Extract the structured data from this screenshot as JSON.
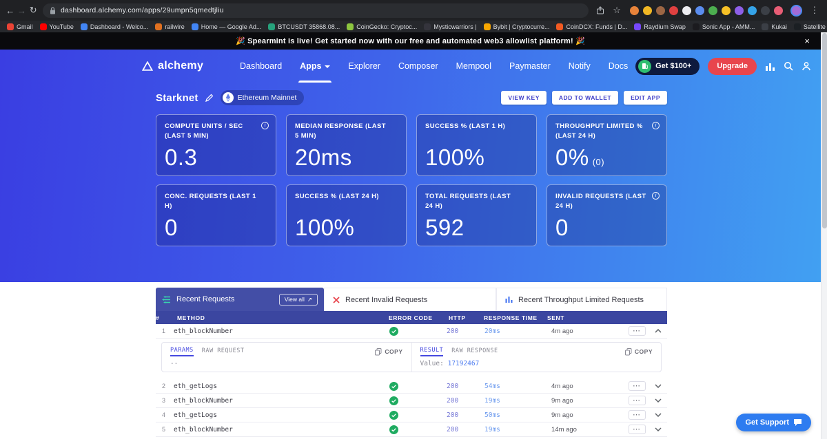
{
  "icons": {
    "back": "←",
    "forward": "→",
    "reload": "↻",
    "more": "⋮",
    "star": "☆",
    "close": "×",
    "dots": "⋯",
    "external": "↗"
  },
  "colors": {
    "gradient_start": "#3a3ee2",
    "gradient_end": "#41a0f2",
    "accent_indigo": "#3b46a0",
    "upgrade_red": "#e8454d",
    "success_green": "#1fab61",
    "http_blue": "#7577d6",
    "time_blue": "#6d9bee"
  },
  "browser": {
    "url": "dashboard.alchemy.com/apps/29umpn5qmedtjliu",
    "extensions": [
      {
        "color": "#e8833a"
      },
      {
        "color": "#f2b824"
      },
      {
        "color": "#9c6644"
      },
      {
        "color": "#e04040"
      },
      {
        "color": "#ececf0"
      },
      {
        "color": "#5b8def"
      },
      {
        "color": "#4cae4f"
      },
      {
        "color": "#f6c026"
      },
      {
        "color": "#8e5fe8"
      },
      {
        "color": "#35a3e8"
      },
      {
        "color": "#3b3f46"
      },
      {
        "color": "#e85d75"
      }
    ],
    "bookmarks": [
      {
        "label": "Gmail",
        "color": "#ea4335"
      },
      {
        "label": "YouTube",
        "color": "#ff0000"
      },
      {
        "label": "Dashboard - Welco...",
        "color": "#4285f4"
      },
      {
        "label": "railwire",
        "color": "#e07020"
      },
      {
        "label": "Home — Google Ad...",
        "color": "#4285f4"
      },
      {
        "label": "BTCUSDT 35868.08...",
        "color": "#26a17b"
      },
      {
        "label": "CoinGecko: Cryptoc...",
        "color": "#8dc63f"
      },
      {
        "label": "Mysticwarriors |",
        "color": "#34343c"
      },
      {
        "label": "Bybit | Cryptocurre...",
        "color": "#f7a600"
      },
      {
        "label": "CoinDCX: Funds | D...",
        "color": "#f15a22"
      },
      {
        "label": "Raydium Swap",
        "color": "#7748fc"
      },
      {
        "label": "Sonic App - AMM...",
        "color": "#1b1b1f"
      },
      {
        "label": "Kukai",
        "color": "#3b3f46"
      },
      {
        "label": "Satellite by Axelar",
        "color": "#1b1f23"
      }
    ]
  },
  "banner": {
    "text": "🎉 Spearmint is live! Get started now with our free and automated web3 allowlist platform! 🎉"
  },
  "header": {
    "brand": "alchemy",
    "nav": [
      {
        "label": "Dashboard"
      },
      {
        "label": "Apps",
        "active": true,
        "caret": true
      },
      {
        "label": "Explorer"
      },
      {
        "label": "Composer"
      },
      {
        "label": "Mempool"
      },
      {
        "label": "Paymaster"
      },
      {
        "label": "Notify"
      },
      {
        "label": "Docs"
      }
    ],
    "credits_button": "Get $100+",
    "upgrade_button": "Upgrade"
  },
  "app": {
    "title": "Starknet",
    "network": "Ethereum Mainnet",
    "actions": [
      {
        "label": "VIEW KEY"
      },
      {
        "label": "ADD TO WALLET"
      },
      {
        "label": "EDIT APP"
      }
    ]
  },
  "metrics": [
    {
      "label": "COMPUTE UNITS / SEC (LAST 5 MIN)",
      "value": "0.3",
      "info": true
    },
    {
      "label": "MEDIAN RESPONSE (LAST 5 MIN)",
      "value": "20ms"
    },
    {
      "label": "SUCCESS % (LAST 1 H)",
      "value": "100%"
    },
    {
      "label": "THROUGHPUT LIMITED % (LAST 24 H)",
      "value": "0%",
      "suffix": "(0)",
      "info": true
    },
    {
      "label": "CONC. REQUESTS (LAST 1 H)",
      "value": "0"
    },
    {
      "label": "SUCCESS % (LAST 24 H)",
      "value": "100%"
    },
    {
      "label": "TOTAL REQUESTS (LAST 24 H)",
      "value": "592"
    },
    {
      "label": "INVALID REQUESTS (LAST 24 H)",
      "value": "0",
      "info": true
    }
  ],
  "requests": {
    "tabs": [
      {
        "label": "Recent Requests",
        "active": true
      },
      {
        "label": "Recent Invalid Requests"
      },
      {
        "label": "Recent Throughput Limited Requests"
      }
    ],
    "view_all": "View all",
    "columns": [
      "#",
      "METHOD",
      "ERROR CODE",
      "HTTP",
      "RESPONSE TIME",
      "SENT"
    ],
    "rows": [
      {
        "num": "1",
        "method": "eth_blockNumber",
        "http": "200",
        "response_time": "20ms",
        "sent": "4m ago",
        "expanded": true
      },
      {
        "num": "2",
        "method": "eth_getLogs",
        "http": "200",
        "response_time": "54ms",
        "sent": "4m ago"
      },
      {
        "num": "3",
        "method": "eth_blockNumber",
        "http": "200",
        "response_time": "19ms",
        "sent": "9m ago"
      },
      {
        "num": "4",
        "method": "eth_getLogs",
        "http": "200",
        "response_time": "50ms",
        "sent": "9m ago"
      },
      {
        "num": "5",
        "method": "eth_blockNumber",
        "http": "200",
        "response_time": "19ms",
        "sent": "14m ago"
      }
    ],
    "detail": {
      "request_tabs": [
        {
          "label": "PARAMS",
          "active": true
        },
        {
          "label": "RAW REQUEST"
        }
      ],
      "response_tabs": [
        {
          "label": "RESULT",
          "active": true
        },
        {
          "label": "RAW RESPONSE"
        }
      ],
      "copy_label": "COPY",
      "params_content": "--",
      "value_label": "Value:",
      "value": "17192467"
    }
  },
  "support": {
    "label": "Get Support"
  }
}
